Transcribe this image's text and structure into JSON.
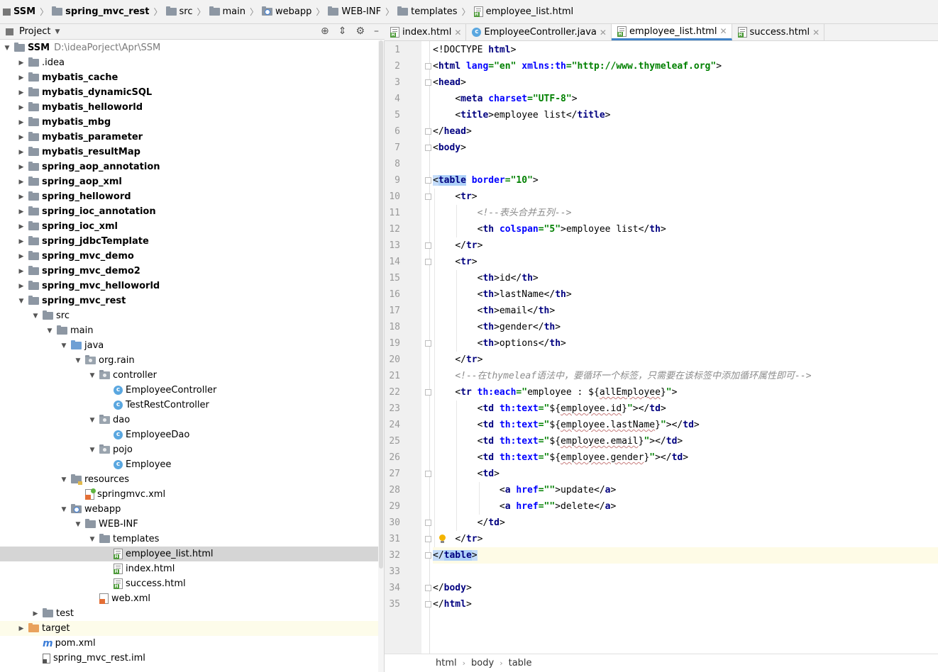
{
  "breadcrumb": [
    {
      "label": "SSM",
      "icon": "project-icon",
      "bold": true
    },
    {
      "label": "spring_mvc_rest",
      "icon": "module-folder-icon",
      "bold": true
    },
    {
      "label": "src",
      "icon": "folder-icon"
    },
    {
      "label": "main",
      "icon": "folder-icon"
    },
    {
      "label": "webapp",
      "icon": "web-folder-icon"
    },
    {
      "label": "WEB-INF",
      "icon": "folder-icon"
    },
    {
      "label": "templates",
      "icon": "folder-icon"
    },
    {
      "label": "employee_list.html",
      "icon": "html-file-icon"
    }
  ],
  "project_panel": {
    "title": "Project",
    "tools": [
      "locate-icon",
      "collapse-icon",
      "gear-icon",
      "hide-icon"
    ]
  },
  "tree": [
    {
      "label": "SSM",
      "path": "D:\\ideaPorject\\Apr\\SSM",
      "icon": "module",
      "depth": 0,
      "arrow": "down",
      "bold": true
    },
    {
      "label": ".idea",
      "icon": "folder",
      "depth": 1,
      "arrow": "right"
    },
    {
      "label": "mybatis_cache",
      "icon": "module",
      "depth": 1,
      "arrow": "right",
      "bold": true
    },
    {
      "label": "mybatis_dynamicSQL",
      "icon": "module",
      "depth": 1,
      "arrow": "right",
      "bold": true
    },
    {
      "label": "mybatis_helloworld",
      "icon": "module",
      "depth": 1,
      "arrow": "right",
      "bold": true
    },
    {
      "label": "mybatis_mbg",
      "icon": "module",
      "depth": 1,
      "arrow": "right",
      "bold": true
    },
    {
      "label": "mybatis_parameter",
      "icon": "module",
      "depth": 1,
      "arrow": "right",
      "bold": true
    },
    {
      "label": "mybatis_resultMap",
      "icon": "module",
      "depth": 1,
      "arrow": "right",
      "bold": true
    },
    {
      "label": "spring_aop_annotation",
      "icon": "module",
      "depth": 1,
      "arrow": "right",
      "bold": true
    },
    {
      "label": "spring_aop_xml",
      "icon": "module",
      "depth": 1,
      "arrow": "right",
      "bold": true
    },
    {
      "label": "spring_helloword",
      "icon": "module",
      "depth": 1,
      "arrow": "right",
      "bold": true
    },
    {
      "label": "spring_ioc_annotation",
      "icon": "module",
      "depth": 1,
      "arrow": "right",
      "bold": true
    },
    {
      "label": "spring_ioc_xml",
      "icon": "module",
      "depth": 1,
      "arrow": "right",
      "bold": true
    },
    {
      "label": "spring_jdbcTemplate",
      "icon": "module",
      "depth": 1,
      "arrow": "right",
      "bold": true
    },
    {
      "label": "spring_mvc_demo",
      "icon": "module",
      "depth": 1,
      "arrow": "right",
      "bold": true
    },
    {
      "label": "spring_mvc_demo2",
      "icon": "module",
      "depth": 1,
      "arrow": "right",
      "bold": true
    },
    {
      "label": "spring_mvc_helloworld",
      "icon": "module",
      "depth": 1,
      "arrow": "right",
      "bold": true
    },
    {
      "label": "spring_mvc_rest",
      "icon": "module",
      "depth": 1,
      "arrow": "down",
      "bold": true
    },
    {
      "label": "src",
      "icon": "folder",
      "depth": 2,
      "arrow": "down"
    },
    {
      "label": "main",
      "icon": "folder",
      "depth": 3,
      "arrow": "down"
    },
    {
      "label": "java",
      "icon": "source-folder",
      "depth": 4,
      "arrow": "down"
    },
    {
      "label": "org.rain",
      "icon": "package",
      "depth": 5,
      "arrow": "down"
    },
    {
      "label": "controller",
      "icon": "package",
      "depth": 6,
      "arrow": "down"
    },
    {
      "label": "EmployeeController",
      "icon": "class",
      "depth": 7,
      "arrow": ""
    },
    {
      "label": "TestRestController",
      "icon": "class",
      "depth": 7,
      "arrow": ""
    },
    {
      "label": "dao",
      "icon": "package",
      "depth": 6,
      "arrow": "down"
    },
    {
      "label": "EmployeeDao",
      "icon": "class",
      "depth": 7,
      "arrow": ""
    },
    {
      "label": "pojo",
      "icon": "package",
      "depth": 6,
      "arrow": "down"
    },
    {
      "label": "Employee",
      "icon": "class",
      "depth": 7,
      "arrow": ""
    },
    {
      "label": "resources",
      "icon": "resources-folder",
      "depth": 4,
      "arrow": "down"
    },
    {
      "label": "springmvc.xml",
      "icon": "spring-xml",
      "depth": 5,
      "arrow": ""
    },
    {
      "label": "webapp",
      "icon": "web-folder",
      "depth": 4,
      "arrow": "down"
    },
    {
      "label": "WEB-INF",
      "icon": "folder",
      "depth": 5,
      "arrow": "down"
    },
    {
      "label": "templates",
      "icon": "folder",
      "depth": 6,
      "arrow": "down"
    },
    {
      "label": "employee_list.html",
      "icon": "html",
      "depth": 7,
      "arrow": "",
      "selected": true
    },
    {
      "label": "index.html",
      "icon": "html",
      "depth": 7,
      "arrow": ""
    },
    {
      "label": "success.html",
      "icon": "html",
      "depth": 7,
      "arrow": ""
    },
    {
      "label": "web.xml",
      "icon": "xml",
      "depth": 6,
      "arrow": ""
    },
    {
      "label": "test",
      "icon": "folder",
      "depth": 2,
      "arrow": "right"
    },
    {
      "label": "target",
      "icon": "excluded-folder",
      "depth": 1,
      "arrow": "right",
      "highlight": true
    },
    {
      "label": "pom.xml",
      "icon": "maven",
      "depth": 2,
      "arrow": ""
    },
    {
      "label": "spring_mvc_rest.iml",
      "icon": "iml",
      "depth": 2,
      "arrow": ""
    }
  ],
  "tabs": [
    {
      "label": "index.html",
      "icon": "html",
      "active": false
    },
    {
      "label": "EmployeeController.java",
      "icon": "class",
      "active": false
    },
    {
      "label": "employee_list.html",
      "icon": "html",
      "active": true
    },
    {
      "label": "success.html",
      "icon": "html",
      "active": false
    }
  ],
  "current_line": 32,
  "fold_lines": [
    2,
    3,
    6,
    7,
    9,
    10,
    13,
    14,
    19,
    22,
    27,
    30,
    31,
    32,
    34,
    35
  ],
  "bulb_line": 31,
  "code_lines": [
    [
      [
        "p",
        "<!DOCTYPE "
      ],
      [
        "t",
        "html"
      ],
      [
        "p",
        ">"
      ]
    ],
    [
      [
        "p",
        "<"
      ],
      [
        "t",
        "html "
      ],
      [
        "a",
        "lang"
      ],
      [
        "s",
        "=\"en\" "
      ],
      [
        "a",
        "xmlns:th"
      ],
      [
        "s",
        "=\"http://www.thymeleaf.org\""
      ],
      [
        "p",
        ">"
      ]
    ],
    [
      [
        "p",
        "<"
      ],
      [
        "t",
        "head"
      ],
      [
        "p",
        ">"
      ]
    ],
    [
      [
        "x",
        "    "
      ],
      [
        "p",
        "<"
      ],
      [
        "t",
        "meta "
      ],
      [
        "a",
        "charset"
      ],
      [
        "s",
        "=\"UTF-8\""
      ],
      [
        "p",
        ">"
      ]
    ],
    [
      [
        "x",
        "    "
      ],
      [
        "p",
        "<"
      ],
      [
        "t",
        "title"
      ],
      [
        "p",
        ">employee list</"
      ],
      [
        "t",
        "title"
      ],
      [
        "p",
        ">"
      ]
    ],
    [
      [
        "p",
        "</"
      ],
      [
        "t",
        "head"
      ],
      [
        "p",
        ">"
      ]
    ],
    [
      [
        "p",
        "<"
      ],
      [
        "t",
        "body"
      ],
      [
        "p",
        ">"
      ]
    ],
    [],
    [
      [
        "h",
        "<"
      ],
      [
        "ht",
        "table"
      ],
      [
        "x",
        " "
      ],
      [
        "a",
        "border"
      ],
      [
        "s",
        "=\"10\""
      ],
      [
        "p",
        ">"
      ]
    ],
    [
      [
        "x",
        "    "
      ],
      [
        "p",
        "<"
      ],
      [
        "t",
        "tr"
      ],
      [
        "p",
        ">"
      ]
    ],
    [
      [
        "x",
        "        "
      ],
      [
        "c",
        "<!--表头合并五列-->"
      ]
    ],
    [
      [
        "x",
        "        "
      ],
      [
        "p",
        "<"
      ],
      [
        "t",
        "th "
      ],
      [
        "a",
        "colspan"
      ],
      [
        "s",
        "=\"5\""
      ],
      [
        "p",
        ">employee list</"
      ],
      [
        "t",
        "th"
      ],
      [
        "p",
        ">"
      ]
    ],
    [
      [
        "x",
        "    "
      ],
      [
        "p",
        "</"
      ],
      [
        "t",
        "tr"
      ],
      [
        "p",
        ">"
      ]
    ],
    [
      [
        "x",
        "    "
      ],
      [
        "p",
        "<"
      ],
      [
        "t",
        "tr"
      ],
      [
        "p",
        ">"
      ]
    ],
    [
      [
        "x",
        "        "
      ],
      [
        "p",
        "<"
      ],
      [
        "t",
        "th"
      ],
      [
        "p",
        ">id</"
      ],
      [
        "t",
        "th"
      ],
      [
        "p",
        ">"
      ]
    ],
    [
      [
        "x",
        "        "
      ],
      [
        "p",
        "<"
      ],
      [
        "t",
        "th"
      ],
      [
        "p",
        ">lastName</"
      ],
      [
        "t",
        "th"
      ],
      [
        "p",
        ">"
      ]
    ],
    [
      [
        "x",
        "        "
      ],
      [
        "p",
        "<"
      ],
      [
        "t",
        "th"
      ],
      [
        "p",
        ">email</"
      ],
      [
        "t",
        "th"
      ],
      [
        "p",
        ">"
      ]
    ],
    [
      [
        "x",
        "        "
      ],
      [
        "p",
        "<"
      ],
      [
        "t",
        "th"
      ],
      [
        "p",
        ">gender</"
      ],
      [
        "t",
        "th"
      ],
      [
        "p",
        ">"
      ]
    ],
    [
      [
        "x",
        "        "
      ],
      [
        "p",
        "<"
      ],
      [
        "t",
        "th"
      ],
      [
        "p",
        ">options</"
      ],
      [
        "t",
        "th"
      ],
      [
        "p",
        ">"
      ]
    ],
    [
      [
        "x",
        "    "
      ],
      [
        "p",
        "</"
      ],
      [
        "t",
        "tr"
      ],
      [
        "p",
        ">"
      ]
    ],
    [
      [
        "x",
        "    "
      ],
      [
        "c",
        "<!--在thymeleaf语法中，要循环一个标签，只需要在该标签中添加循环属性即可-->"
      ]
    ],
    [
      [
        "x",
        "    "
      ],
      [
        "p",
        "<"
      ],
      [
        "t",
        "tr "
      ],
      [
        "a",
        "th:each"
      ],
      [
        "s",
        "=\""
      ],
      [
        "x",
        "employee : ${"
      ],
      [
        "e",
        "allEmployee"
      ],
      [
        "x",
        "}"
      ],
      [
        "s",
        "\""
      ],
      [
        "p",
        ">"
      ]
    ],
    [
      [
        "x",
        "        "
      ],
      [
        "p",
        "<"
      ],
      [
        "t",
        "td "
      ],
      [
        "a",
        "th:text"
      ],
      [
        "s",
        "=\""
      ],
      [
        "x",
        "${"
      ],
      [
        "e",
        "employee.id"
      ],
      [
        "x",
        "}"
      ],
      [
        "s",
        "\""
      ],
      [
        "p",
        "></"
      ],
      [
        "t",
        "td"
      ],
      [
        "p",
        ">"
      ]
    ],
    [
      [
        "x",
        "        "
      ],
      [
        "p",
        "<"
      ],
      [
        "t",
        "td "
      ],
      [
        "a",
        "th:text"
      ],
      [
        "s",
        "=\""
      ],
      [
        "x",
        "${"
      ],
      [
        "e",
        "employee.lastName"
      ],
      [
        "x",
        "}"
      ],
      [
        "s",
        "\""
      ],
      [
        "p",
        "></"
      ],
      [
        "t",
        "td"
      ],
      [
        "p",
        ">"
      ]
    ],
    [
      [
        "x",
        "        "
      ],
      [
        "p",
        "<"
      ],
      [
        "t",
        "td "
      ],
      [
        "a",
        "th:text"
      ],
      [
        "s",
        "=\""
      ],
      [
        "x",
        "${"
      ],
      [
        "e",
        "employee.email"
      ],
      [
        "x",
        "}"
      ],
      [
        "s",
        "\""
      ],
      [
        "p",
        "></"
      ],
      [
        "t",
        "td"
      ],
      [
        "p",
        ">"
      ]
    ],
    [
      [
        "x",
        "        "
      ],
      [
        "p",
        "<"
      ],
      [
        "t",
        "td "
      ],
      [
        "a",
        "th:text"
      ],
      [
        "s",
        "=\""
      ],
      [
        "x",
        "${"
      ],
      [
        "e",
        "employee.gender"
      ],
      [
        "x",
        "}"
      ],
      [
        "s",
        "\""
      ],
      [
        "p",
        "></"
      ],
      [
        "t",
        "td"
      ],
      [
        "p",
        ">"
      ]
    ],
    [
      [
        "x",
        "        "
      ],
      [
        "p",
        "<"
      ],
      [
        "t",
        "td"
      ],
      [
        "p",
        ">"
      ]
    ],
    [
      [
        "x",
        "            "
      ],
      [
        "p",
        "<"
      ],
      [
        "t",
        "a "
      ],
      [
        "a",
        "href"
      ],
      [
        "s",
        "=\"\""
      ],
      [
        "p",
        ">update</"
      ],
      [
        "t",
        "a"
      ],
      [
        "p",
        ">"
      ]
    ],
    [
      [
        "x",
        "            "
      ],
      [
        "p",
        "<"
      ],
      [
        "t",
        "a "
      ],
      [
        "a",
        "href"
      ],
      [
        "s",
        "=\"\""
      ],
      [
        "p",
        ">delete</"
      ],
      [
        "t",
        "a"
      ],
      [
        "p",
        ">"
      ]
    ],
    [
      [
        "x",
        "        "
      ],
      [
        "p",
        "</"
      ],
      [
        "t",
        "td"
      ],
      [
        "p",
        ">"
      ]
    ],
    [
      [
        "x",
        "    "
      ],
      [
        "p",
        "</"
      ],
      [
        "t",
        "tr"
      ],
      [
        "p",
        ">"
      ]
    ],
    [
      [
        "h",
        "</"
      ],
      [
        "ht",
        "table"
      ],
      [
        "h",
        ">"
      ]
    ],
    [],
    [
      [
        "p",
        "</"
      ],
      [
        "t",
        "body"
      ],
      [
        "p",
        ">"
      ]
    ],
    [
      [
        "p",
        "</"
      ],
      [
        "t",
        "html"
      ],
      [
        "p",
        ">"
      ]
    ]
  ],
  "status_breadcrumb": [
    "html",
    "body",
    "table"
  ]
}
